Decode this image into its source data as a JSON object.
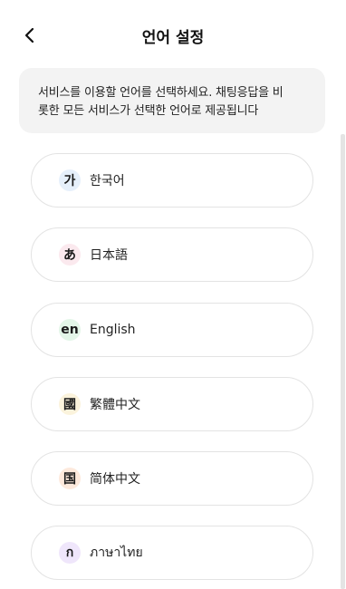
{
  "header": {
    "title": "언어 설정",
    "back_icon": "chevron-left-icon"
  },
  "notice": {
    "text_line1": "서비스를 이용할 언어를 선택하세요. 채팅응답을 비",
    "text_line2": "롯한 모든 서비스가 선택한 언어로 제공됩니다"
  },
  "languages": [
    {
      "badge": "가",
      "label": "한국어",
      "badge_color": "#e6f0fb"
    },
    {
      "badge": "あ",
      "label": "日本語",
      "badge_color": "#fbe9ee"
    },
    {
      "badge": "en",
      "label": "English",
      "badge_color": "#e3f6e8"
    },
    {
      "badge": "國",
      "label": "繁體中文",
      "badge_color": "#fbf3dc"
    },
    {
      "badge": "国",
      "label": "简体中文",
      "badge_color": "#fde9dc"
    },
    {
      "badge": "ก",
      "label": "ภาษาไทย",
      "badge_color": "#efe6fb"
    }
  ]
}
